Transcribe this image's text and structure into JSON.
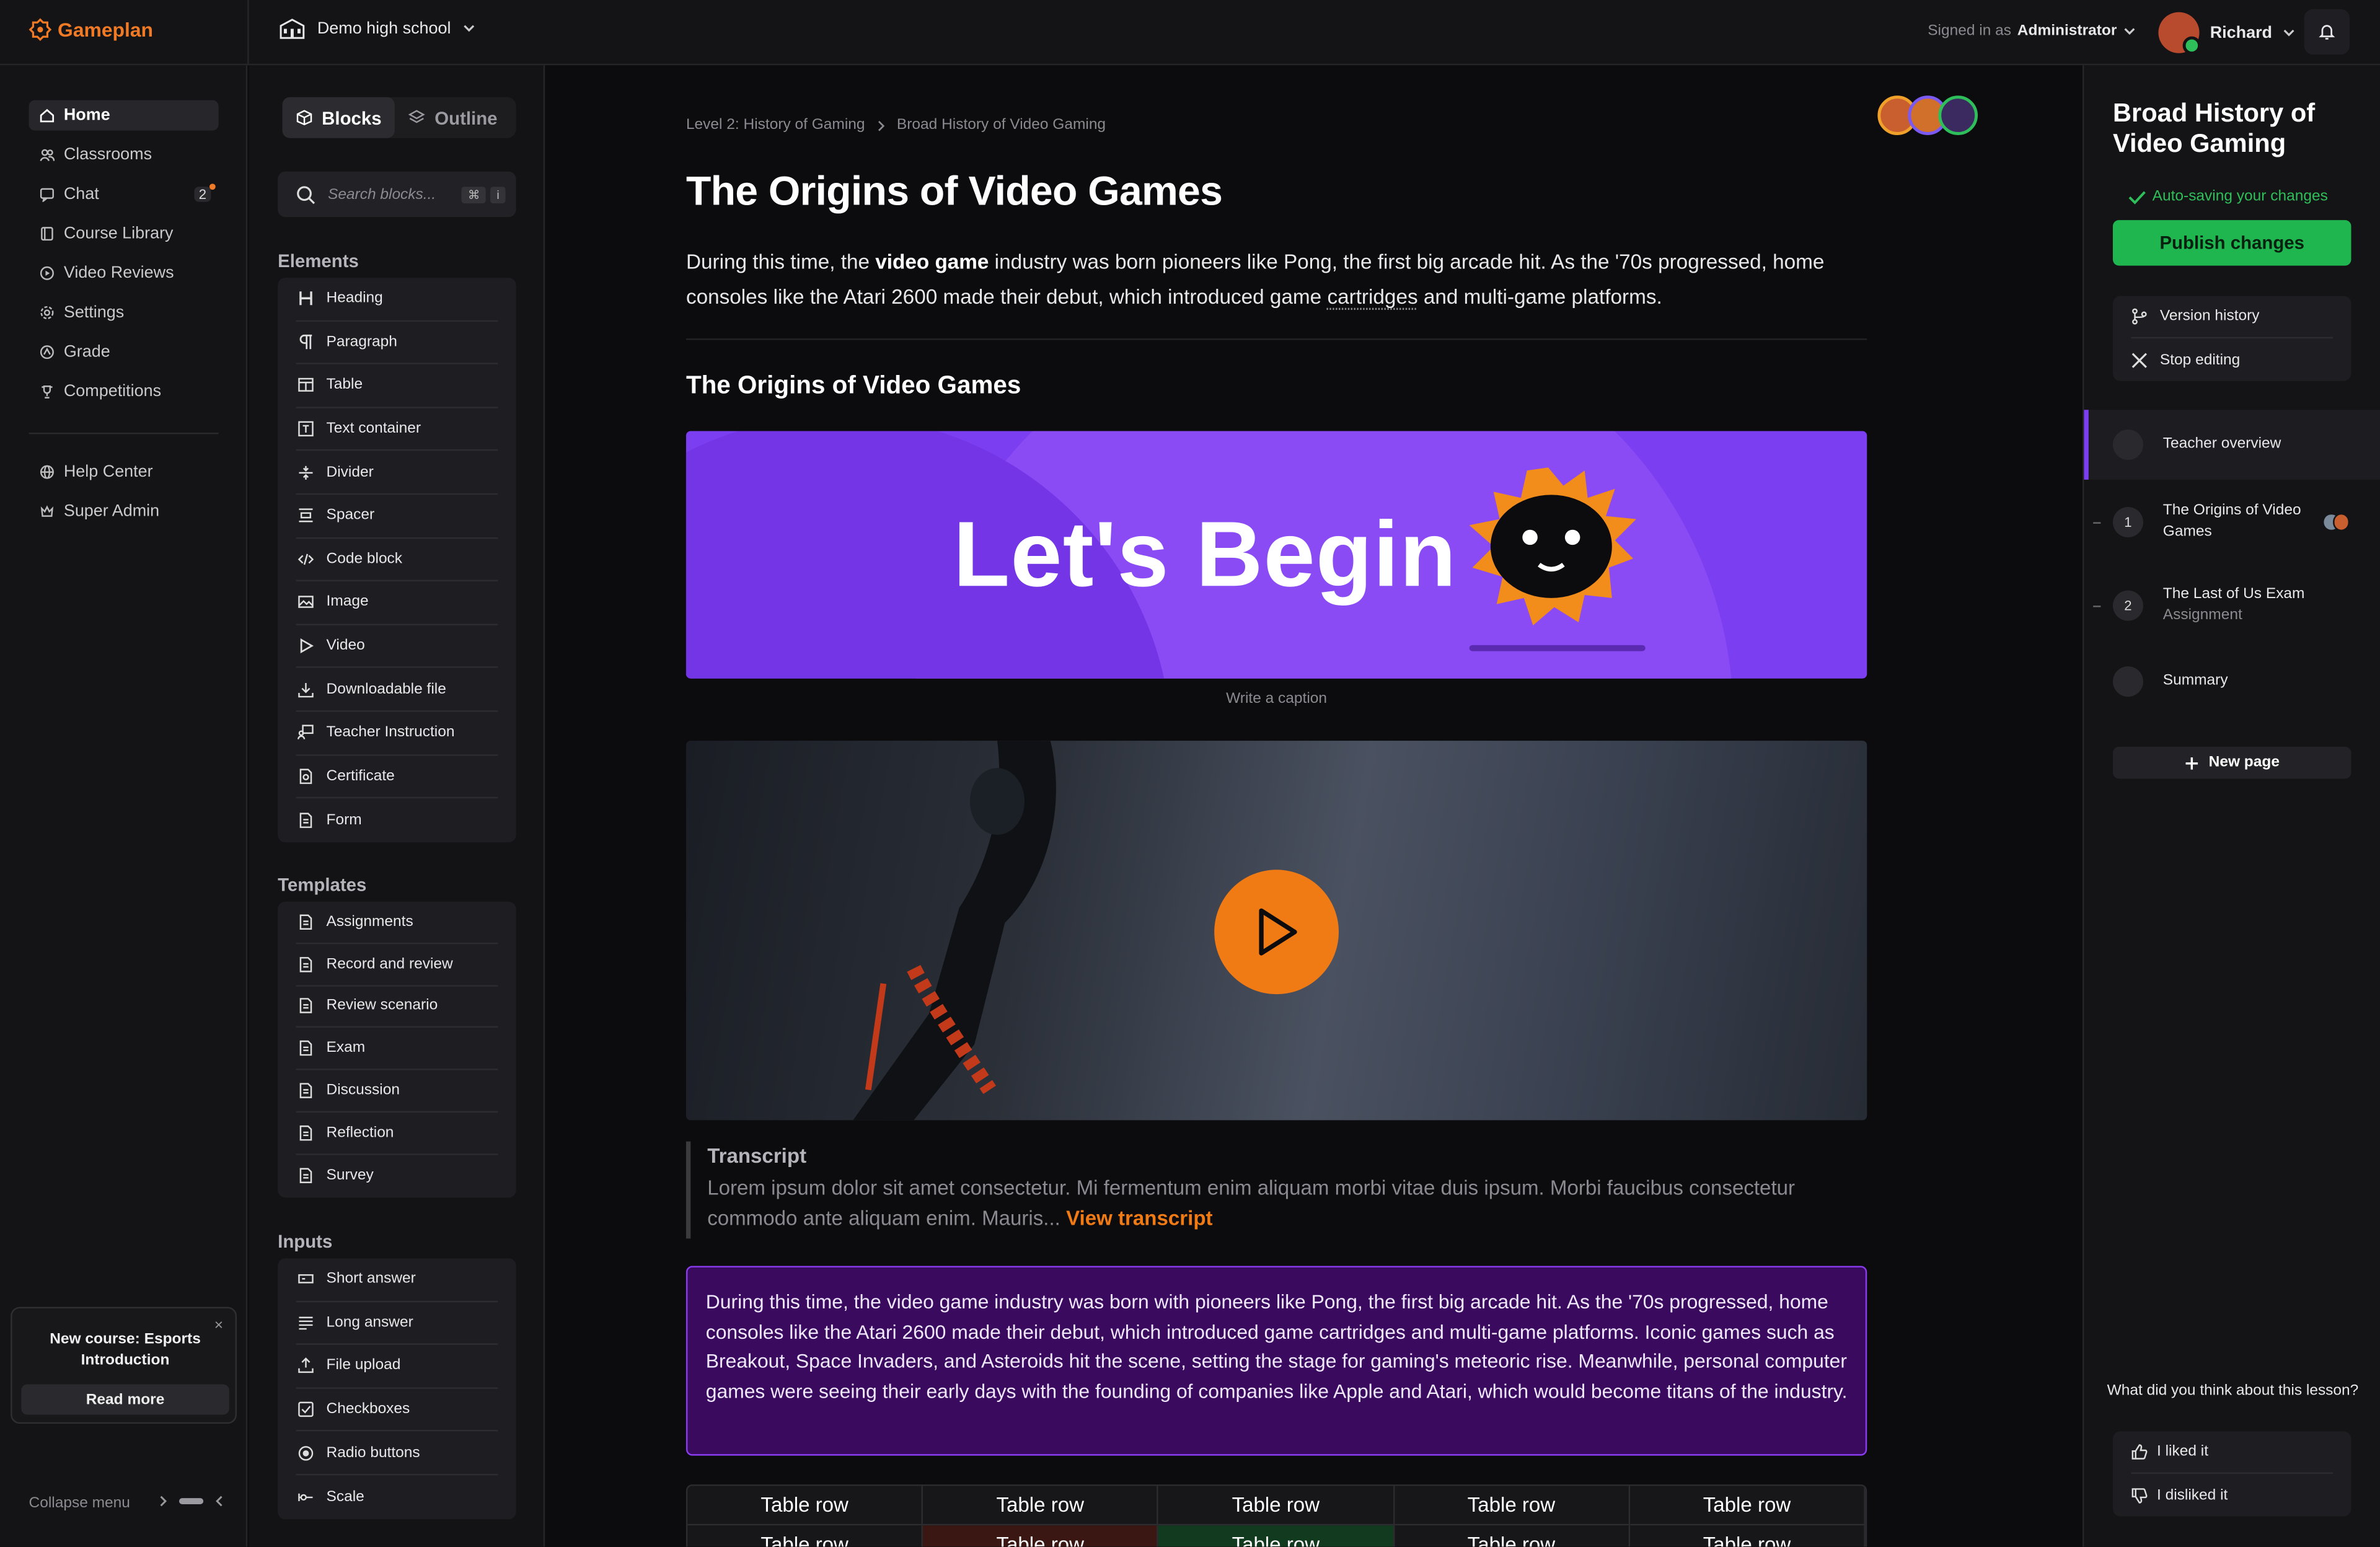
{
  "app": {
    "name": "Gameplan",
    "accent": "#f07a25"
  },
  "topbar": {
    "school": "Demo high school",
    "signed_in_prefix": "Signed in as",
    "role": "Administrator",
    "user_name": "Richard"
  },
  "nav": {
    "items": [
      {
        "label": "Home",
        "icon": "home-icon"
      },
      {
        "label": "Classrooms",
        "icon": "people-icon"
      },
      {
        "label": "Chat",
        "icon": "chat-icon",
        "badge": "2"
      },
      {
        "label": "Course Library",
        "icon": "book-icon"
      },
      {
        "label": "Video Reviews",
        "icon": "play-circle-icon"
      },
      {
        "label": "Settings",
        "icon": "gear-icon"
      },
      {
        "label": "Grade",
        "icon": "grade-icon"
      },
      {
        "label": "Competitions",
        "icon": "trophy-icon"
      }
    ],
    "secondary": [
      {
        "label": "Help Center",
        "icon": "globe-icon"
      },
      {
        "label": "Super Admin",
        "icon": "crown-icon"
      }
    ],
    "promo": {
      "title": "New course: Esports Introduction",
      "button": "Read more",
      "close": "×"
    },
    "collapse_label": "Collapse menu"
  },
  "blocks_panel": {
    "tabs": [
      "Blocks",
      "Outline"
    ],
    "search_placeholder": "Search blocks...",
    "shortcut": [
      "⌘",
      "i"
    ],
    "elements_title": "Elements",
    "elements": [
      "Heading",
      "Paragraph",
      "Table",
      "Text container",
      "Divider",
      "Spacer",
      "Code block",
      "Image",
      "Video",
      "Downloadable file",
      "Teacher Instruction",
      "Certificate",
      "Form"
    ],
    "templates_title": "Templates",
    "templates": [
      "Assignments",
      "Record and review",
      "Review scenario",
      "Exam",
      "Discussion",
      "Reflection",
      "Survey"
    ],
    "inputs_title": "Inputs",
    "inputs": [
      "Short answer",
      "Long answer",
      "File upload",
      "Checkboxes",
      "Radio buttons",
      "Scale"
    ]
  },
  "main": {
    "breadcrumb": [
      "Level 2: History of Gaming",
      "Broad History of Video Gaming"
    ],
    "title": "The Origins of Video Games",
    "lead_before": "During this time, the ",
    "lead_bold": "video game",
    "lead_middle": " industry was born pioneers like Pong, the first big arcade hit. As the '70s progressed, home consoles like the Atari 2600 made their debut, which introduced game ",
    "lead_underlined": "cartridges",
    "lead_after": " and multi-game platforms.",
    "section_title": "The Origins of Video Games",
    "banner_text": "Let's Begin",
    "caption_placeholder": "Write a caption",
    "transcript_title": "Transcript",
    "transcript_text": "Lorem ipsum dolor sit amet consectetur. Mi fermentum enim aliquam morbi vitae duis ipsum. Morbi faucibus consectetur commodo ante aliquam enim. Mauris...",
    "transcript_link": "View transcript",
    "callout": "During this time, the video game industry was born with pioneers like Pong, the first big arcade hit. As the '70s progressed, home consoles like the Atari 2600 made their debut, which introduced game cartridges and multi-game platforms. Iconic games such as Breakout, Space Invaders, and Asteroids hit the scene, setting the stage for gaming's meteoric rise. Meanwhile, personal computer games were seeing their early days with the founding of companies like Apple and Atari, which would become titans of the industry.",
    "table_rows": [
      [
        "Table row",
        "Table row",
        "Table row",
        "Table row",
        "Table row"
      ],
      [
        "Table row",
        "Table row",
        "Table row",
        "Table row",
        "Table row"
      ]
    ]
  },
  "right": {
    "title": "Broad History of Video Gaming",
    "saving": "Auto-saving your changes",
    "publish": "Publish changes",
    "menu": [
      "Version history",
      "Stop editing"
    ],
    "pages": [
      {
        "number": "",
        "title": "Teacher overview",
        "subtitle": ""
      },
      {
        "number": "1",
        "title": "The Origins of Video Games",
        "subtitle": ""
      },
      {
        "number": "2",
        "title": "The Last of Us Exam",
        "subtitle": "Assignment"
      },
      {
        "number": "",
        "title": "Summary",
        "subtitle": ""
      }
    ],
    "new_page": "New page",
    "feedback_question": "What did you think about this lesson?",
    "feedback": [
      "I liked it",
      "I disliked it"
    ]
  }
}
